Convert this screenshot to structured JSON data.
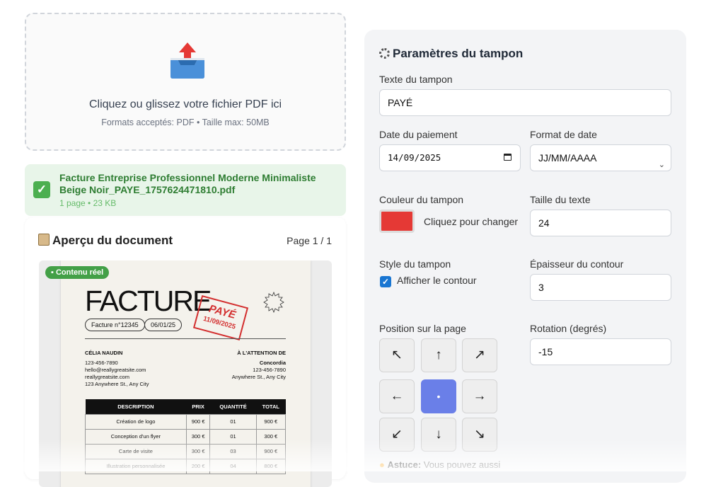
{
  "upload": {
    "title": "Cliquez ou glissez votre fichier PDF ici",
    "subtitle": "Formats acceptés: PDF • Taille max: 50MB",
    "icon": "upload-tray-icon"
  },
  "file": {
    "name": "Facture Entreprise Professionnel Moderne Minimaliste Beige Noir_PAYE_1757624471810.pdf",
    "meta": "1 page • 23 KB",
    "status_icon": "check-icon"
  },
  "preview": {
    "title": "Aperçu du document",
    "page": "Page 1 / 1",
    "badge": "Contenu réel",
    "doc": {
      "heading": "FACTURE",
      "invoice_no": "Facture n°12345",
      "date": "06/01/25",
      "stamp_text": "PAYÉ",
      "stamp_date": "11/09/2025",
      "from_name": "CÉLIA NAUDIN",
      "from_lines": [
        "123-456-7890",
        "hello@reallygreatsite.com",
        "reallygreatsite.com",
        "123 Anywhere St., Any City"
      ],
      "to_title": "À L'ATTENTION DE",
      "to_name": "Concordia",
      "to_lines": [
        "123-456-7890",
        "Anywhere St., Any City"
      ],
      "columns": [
        "DESCRIPTION",
        "PRIX",
        "QUANTITÉ",
        "TOTAL"
      ],
      "rows": [
        [
          "Création de logo",
          "900 €",
          "01",
          "900 €"
        ],
        [
          "Conception d'un flyer",
          "300 €",
          "01",
          "300 €"
        ],
        [
          "Carte de visite",
          "300 €",
          "03",
          "900 €"
        ],
        [
          "Illustration personnalisée",
          "200 €",
          "04",
          "800 €"
        ]
      ]
    }
  },
  "settings": {
    "title": "Paramètres du tampon",
    "stamp_text_label": "Texte du tampon",
    "stamp_text_value": "PAYÉ",
    "date_label": "Date du paiement",
    "date_value": "14/09/2025",
    "date_format_label": "Format de date",
    "date_format_value": "JJ/MM/AAAA",
    "color_label": "Couleur du tampon",
    "color_value": "#e53935",
    "color_button": "Cliquez pour changer",
    "size_label": "Taille du texte",
    "size_value": "24",
    "style_label": "Style du tampon",
    "border_checkbox": "Afficher le contour",
    "border_checked": true,
    "thickness_label": "Épaisseur du contour",
    "thickness_value": "3",
    "position_label": "Position sur la page",
    "positions": [
      "↖",
      "↑",
      "↗",
      "←",
      "•",
      "→",
      "↙",
      "↓",
      "↘"
    ],
    "selected_position": "•",
    "rotation_label": "Rotation (degrés)",
    "rotation_value": "-15",
    "tip_label": "Astuce:",
    "tip_text": "Vous pouvez aussi"
  }
}
